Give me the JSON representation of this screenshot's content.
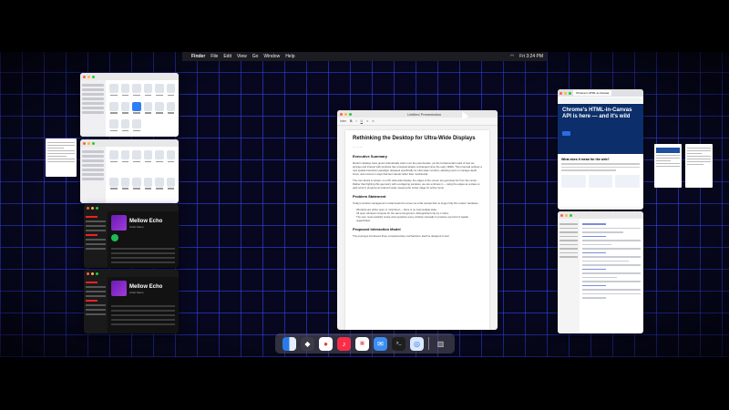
{
  "menubar": {
    "apple": "",
    "app_name": "Finder",
    "menus": [
      "File",
      "Edit",
      "View",
      "Go",
      "Window",
      "Help"
    ],
    "clock": "Fri 3:24 PM"
  },
  "document": {
    "window_title": "Untitled Presentation",
    "toolbar_font": "Inter",
    "title": "Rethinking the Desktop for Ultra-Wide Displays",
    "sections": [
      {
        "heading": "Executive Summary",
        "paragraphs": [
          "Modern displays have grown dramatically wider over the past decade, yet the fundamental model of how we arrange and interact with windows has remained largely unchanged since the early 1990s. This proposal outlines a new spatial interaction paradigm designed specifically for ultra-wide monitors, allowing users to manage depth, focus, and context in ways that feel natural rather than mechanical.",
          "The core thesis is simple: on a 5K ultra-wide display, the edges of the screen are genuinely far from the center. Rather than fighting this geometry with overlapping windows, we can embrace it — using the edges as a place to park work in progress at reduced scale, keeping the center stage for active focus."
        ]
      },
      {
        "heading": "Problem Statement",
        "paragraphs": [
          "Today's window management model treats the screen as a flat canvas that no longer fully fits modern hardware."
        ],
        "bullets": [
          "Windows are either open or minimized — there is no intermediate state.",
          "All open windows compete for the same foreground, distinguished only by z-index.",
          "The user must explicitly resize and reposition every window manually to produce any kind of spatial organization."
        ]
      },
      {
        "heading": "Proposed Interaction Model",
        "paragraphs": [
          "The prototype introduces three complementary mechanisms. Each is designed to feel"
        ]
      }
    ]
  },
  "music": {
    "album": "Mellow Echo",
    "artist": "Artist Name"
  },
  "browser": {
    "tab_label": "Chrome's HTML-in-Canvas",
    "headline": "Chrome's HTML-in-Canvas API is here — and it's wild",
    "section_heading": "What does it mean for the web?"
  },
  "dock": {
    "apps": [
      "finder",
      "launchpad",
      "chrome",
      "music",
      "calendar",
      "mail",
      "terminal",
      "safari",
      "trash"
    ]
  }
}
